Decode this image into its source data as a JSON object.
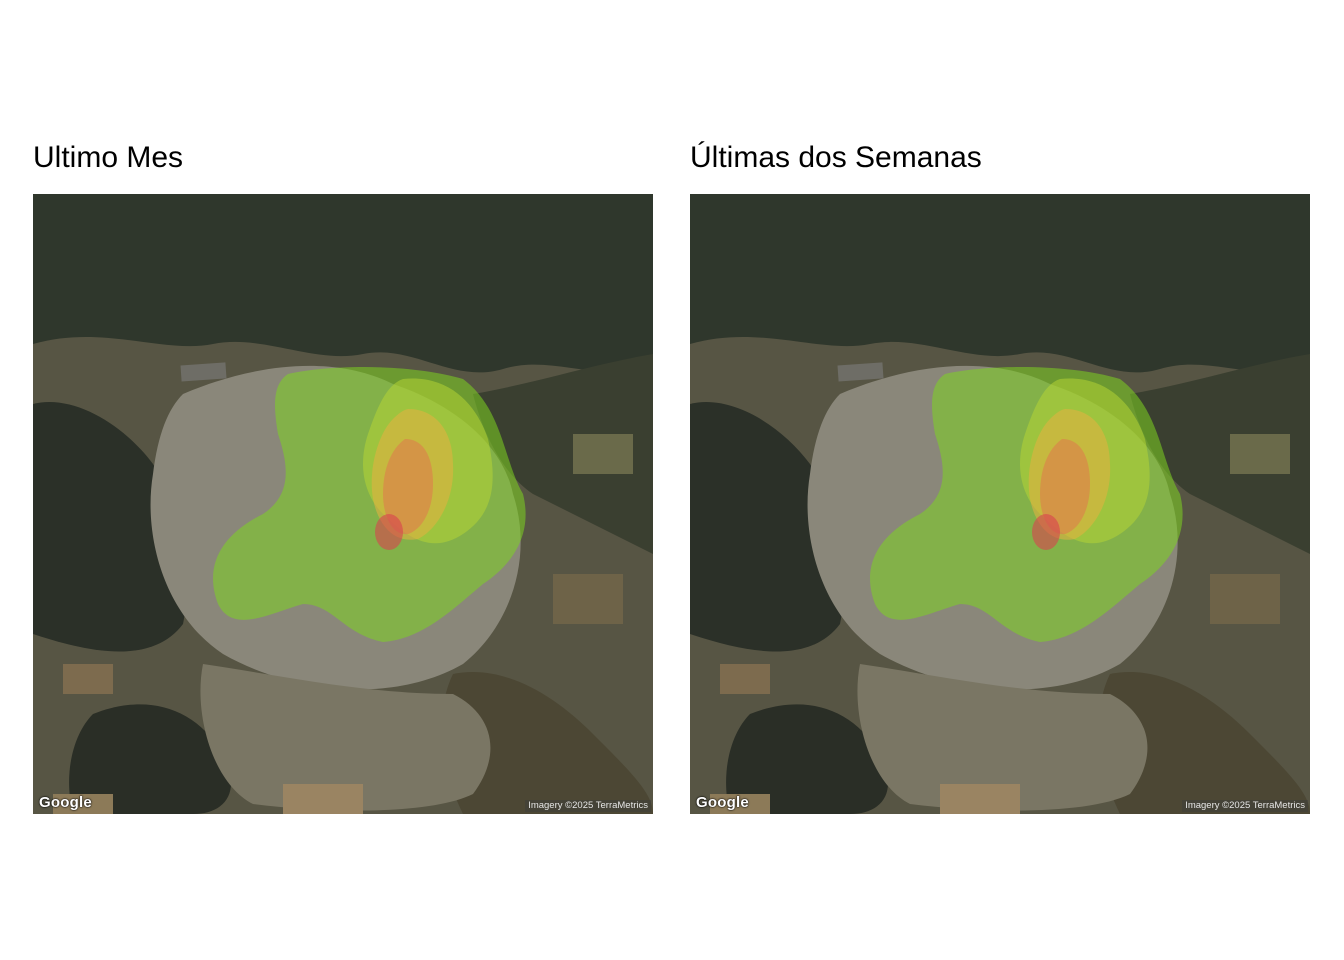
{
  "panels": [
    {
      "title": "Ultimo Mes",
      "map": {
        "logo": "Google",
        "attribution": "Imagery ©2025 TerraMetrics",
        "basemap": "satellite",
        "overlay": "density-heatmap",
        "heat_colors": [
          "#7ed321",
          "#b5d334",
          "#e8b040",
          "#e56a50",
          "#d9434e"
        ]
      }
    },
    {
      "title": "Últimas dos Semanas",
      "map": {
        "logo": "Google",
        "attribution": "Imagery ©2025 TerraMetrics",
        "basemap": "satellite",
        "overlay": "density-heatmap",
        "heat_colors": [
          "#7ed321",
          "#b5d334",
          "#e8b040",
          "#e56a50",
          "#d9434e"
        ]
      }
    }
  ]
}
